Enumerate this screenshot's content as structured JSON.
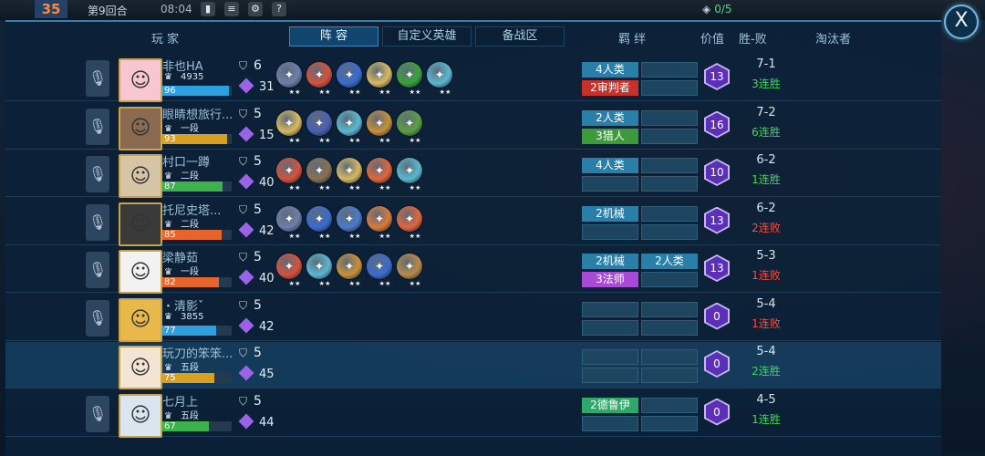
{
  "topbar": {
    "round_badge": "35",
    "round_label": "第9回合",
    "time": "08:04",
    "counter": "0/5"
  },
  "close_label": "X",
  "headers": {
    "player": "玩 家",
    "tabs": [
      "阵 容",
      "自定义英雄",
      "备战区"
    ],
    "synergy": "羁 绊",
    "value": "价值",
    "record": "胜-败",
    "eliminator": "淘汰者"
  },
  "players": [
    {
      "name": "非也HA",
      "rank": "4935",
      "hp": "96",
      "hp_pct": 96,
      "hp_color": "#2ea0e0",
      "level": "6",
      "gold": "31",
      "avatar_color": "#f7c6d0",
      "units": [
        "#6e7ea8",
        "#d5523a",
        "#3b6bd1",
        "#d9b860",
        "#3aa23a",
        "#5ab8d0"
      ],
      "synergies": [
        {
          "label": "4人类",
          "cls": "human"
        },
        {
          "label": "2审判者",
          "cls": "judge"
        }
      ],
      "synergies_col2": [],
      "value": "13",
      "record": "7-1",
      "streak": "3连胜",
      "streak_type": "win"
    },
    {
      "name": "眼睛想旅行...",
      "rank": "一段",
      "hp": "93",
      "hp_pct": 93,
      "hp_color": "#d8a020",
      "level": "5",
      "gold": "15",
      "avatar_color": "#8a6a50",
      "units": [
        "#d9b860",
        "#4c5fb0",
        "#5ab8d0",
        "#c8903a",
        "#5aa040"
      ],
      "synergies": [
        {
          "label": "2人类",
          "cls": "human"
        },
        {
          "label": "3猎人",
          "cls": "hunter"
        }
      ],
      "synergies_col2": [],
      "value": "16",
      "record": "7-2",
      "streak": "6连胜",
      "streak_type": "win"
    },
    {
      "name": "村口一蹲",
      "rank": "二段",
      "hp": "87",
      "hp_pct": 87,
      "hp_color": "#3bb34a",
      "level": "5",
      "gold": "40",
      "avatar_color": "#d7c4a6",
      "units": [
        "#d5523a",
        "#8a7050",
        "#d9b860",
        "#e2653a",
        "#5ab8d0"
      ],
      "synergies": [
        {
          "label": "4人类",
          "cls": "human"
        }
      ],
      "synergies_col2": [],
      "value": "10",
      "record": "6-2",
      "streak": "1连胜",
      "streak_type": "win"
    },
    {
      "name": "托尼史塔...",
      "rank": "二段",
      "hp": "85",
      "hp_pct": 85,
      "hp_color": "#e8642a",
      "level": "5",
      "gold": "42",
      "avatar_color": "#3a3a3a",
      "units": [
        "#6e7ea8",
        "#3b6bd1",
        "#4a7ac8",
        "#d97a3a",
        "#e2653a"
      ],
      "synergies": [
        {
          "label": "2机械",
          "cls": "mech"
        }
      ],
      "synergies_col2": [],
      "value": "13",
      "record": "6-2",
      "streak": "2连败",
      "streak_type": "lose"
    },
    {
      "name": "梁静茹",
      "rank": "一段",
      "hp": "82",
      "hp_pct": 82,
      "hp_color": "#e8642a",
      "level": "5",
      "gold": "40",
      "avatar_color": "#f2f2f2",
      "units": [
        "#d5523a",
        "#5ab8d0",
        "#c8903a",
        "#3b6bd1",
        "#b88a4a"
      ],
      "synergies": [
        {
          "label": "2机械",
          "cls": "mech"
        },
        {
          "label": "3法师",
          "cls": "mage"
        }
      ],
      "synergies_col2": [
        {
          "label": "2人类",
          "cls": "human"
        }
      ],
      "value": "13",
      "record": "5-3",
      "streak": "1连败",
      "streak_type": "lose"
    },
    {
      "name": "・清影ˇ",
      "rank": "3855",
      "hp": "77",
      "hp_pct": 77,
      "hp_color": "#2ea0e0",
      "level": "5",
      "gold": "42",
      "avatar_color": "#e8b84a",
      "units": [],
      "synergies": [],
      "synergies_col2": [],
      "value": "0",
      "record": "5-4",
      "streak": "1连败",
      "streak_type": "lose"
    },
    {
      "name": "玩刀的笨笨...",
      "rank": "五段",
      "hp": "75",
      "hp_pct": 75,
      "hp_color": "#d8a020",
      "level": "5",
      "gold": "45",
      "avatar_color": "#f3e4d4",
      "units": [],
      "synergies": [],
      "synergies_col2": [],
      "value": "0",
      "record": "5-4",
      "streak": "2连胜",
      "streak_type": "win"
    },
    {
      "name": "七月上",
      "rank": "五段",
      "hp": "67",
      "hp_pct": 67,
      "hp_color": "#3bb34a",
      "level": "5",
      "gold": "44",
      "avatar_color": "#d9e6f0",
      "units": [],
      "synergies": [
        {
          "label": "2德鲁伊",
          "cls": "druid"
        }
      ],
      "synergies_col2": [],
      "value": "0",
      "record": "4-5",
      "streak": "1连胜",
      "streak_type": "win"
    }
  ]
}
